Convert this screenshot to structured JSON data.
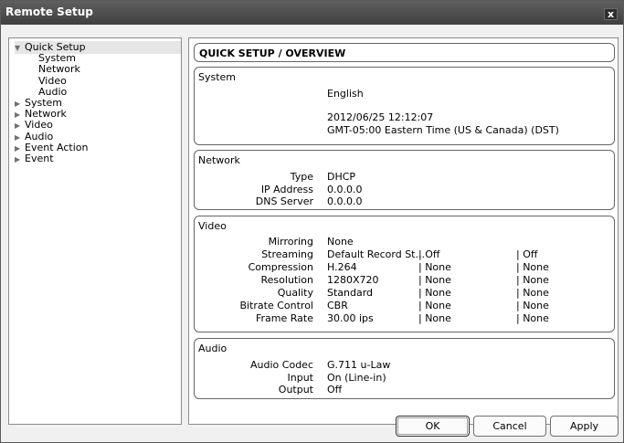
{
  "window": {
    "title": "Remote Setup",
    "close_label": "x"
  },
  "tree": [
    {
      "label": "Quick Setup",
      "arrow": "▼",
      "selected": true,
      "indent": 0
    },
    {
      "label": "System",
      "arrow": "",
      "indent": 1
    },
    {
      "label": "Network",
      "arrow": "",
      "indent": 1
    },
    {
      "label": "Video",
      "arrow": "",
      "indent": 1
    },
    {
      "label": "Audio",
      "arrow": "",
      "indent": 1
    },
    {
      "label": "System",
      "arrow": "▶",
      "indent": 0
    },
    {
      "label": "Network",
      "arrow": "▶",
      "indent": 0
    },
    {
      "label": "Video",
      "arrow": "▶",
      "indent": 0
    },
    {
      "label": "Audio",
      "arrow": "▶",
      "indent": 0
    },
    {
      "label": "Event Action",
      "arrow": "▶",
      "indent": 0
    },
    {
      "label": "Event",
      "arrow": "▶",
      "indent": 0
    }
  ],
  "heading": "QUICK SETUP / OVERVIEW",
  "system": {
    "title": "System",
    "language": "English",
    "datetime": "2012/06/25 12:12:07",
    "timezone": "GMT-05:00 Eastern Time (US & Canada) (DST)"
  },
  "network": {
    "title": "Network",
    "rows": [
      {
        "label": "Type",
        "value": "DHCP"
      },
      {
        "label": "IP Address",
        "value": "0.0.0.0"
      },
      {
        "label": "DNS Server",
        "value": "0.0.0.0"
      }
    ]
  },
  "video": {
    "title": "Video",
    "rows": [
      {
        "label": "Mirroring",
        "v1": "None",
        "v2": "",
        "v3": ""
      },
      {
        "label": "Streaming",
        "v1": "Default Record St...",
        "v2": "| Off",
        "v3": "| Off"
      },
      {
        "label": "Compression",
        "v1": "H.264",
        "v2": "| None",
        "v3": "| None"
      },
      {
        "label": "Resolution",
        "v1": "1280X720",
        "v2": "| None",
        "v3": "| None"
      },
      {
        "label": "Quality",
        "v1": "Standard",
        "v2": "| None",
        "v3": "| None"
      },
      {
        "label": "Bitrate Control",
        "v1": "CBR",
        "v2": "| None",
        "v3": "| None"
      },
      {
        "label": "Frame Rate",
        "v1": "30.00 ips",
        "v2": "| None",
        "v3": "| None"
      }
    ]
  },
  "audio": {
    "title": "Audio",
    "rows": [
      {
        "label": "Audio Codec",
        "value": "G.711 u-Law"
      },
      {
        "label": "Input",
        "value": "On (Line-in)"
      },
      {
        "label": "Output",
        "value": "Off"
      }
    ]
  },
  "buttons": {
    "ok": "OK",
    "cancel": "Cancel",
    "apply": "Apply"
  }
}
